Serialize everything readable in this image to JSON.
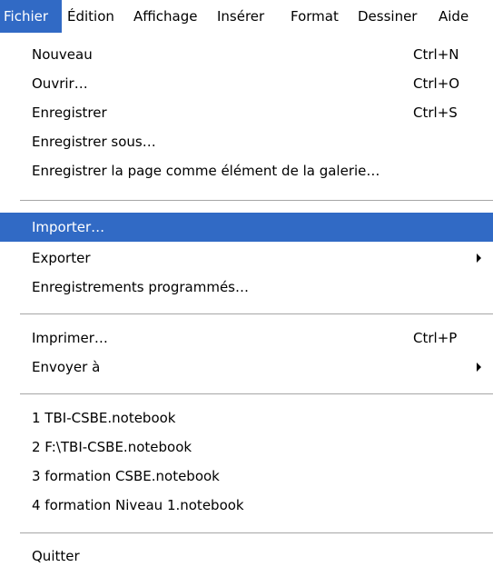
{
  "menubar": {
    "items": [
      {
        "label": "Fichier"
      },
      {
        "label": "Édition"
      },
      {
        "label": "Affichage"
      },
      {
        "label": "Insérer"
      },
      {
        "label": "Format"
      },
      {
        "label": "Dessiner"
      },
      {
        "label": "Aide"
      }
    ],
    "active_item": "Fichier"
  },
  "file_menu": {
    "new": {
      "label": "Nouveau",
      "shortcut": "Ctrl+N"
    },
    "open": {
      "label": "Ouvrir…",
      "shortcut": "Ctrl+O"
    },
    "save": {
      "label": "Enregistrer",
      "shortcut": "Ctrl+S"
    },
    "save_as": {
      "label": "Enregistrer sous…"
    },
    "save_gallery": {
      "label": "Enregistrer la page comme élément de la galerie…"
    },
    "import": {
      "label": "Importer…",
      "highlighted": true
    },
    "export": {
      "label": "Exporter",
      "submenu_icon": "submenu-arrow-icon"
    },
    "scheduled": {
      "label": "Enregistrements programmés…"
    },
    "print": {
      "label": "Imprimer…",
      "shortcut": "Ctrl+P"
    },
    "send_to": {
      "label": "Envoyer à",
      "submenu_icon": "submenu-arrow-icon"
    },
    "recent": [
      {
        "label": "1 TBI-CSBE.notebook"
      },
      {
        "label": "2 F:\\TBI-CSBE.notebook"
      },
      {
        "label": "3 formation CSBE.notebook"
      },
      {
        "label": "4 formation Niveau 1.notebook"
      }
    ],
    "quit": {
      "label": "Quitter"
    }
  },
  "colors": {
    "highlight": "#316ac5",
    "highlight_text": "#ffffff",
    "separator": "#a6a6a6"
  }
}
